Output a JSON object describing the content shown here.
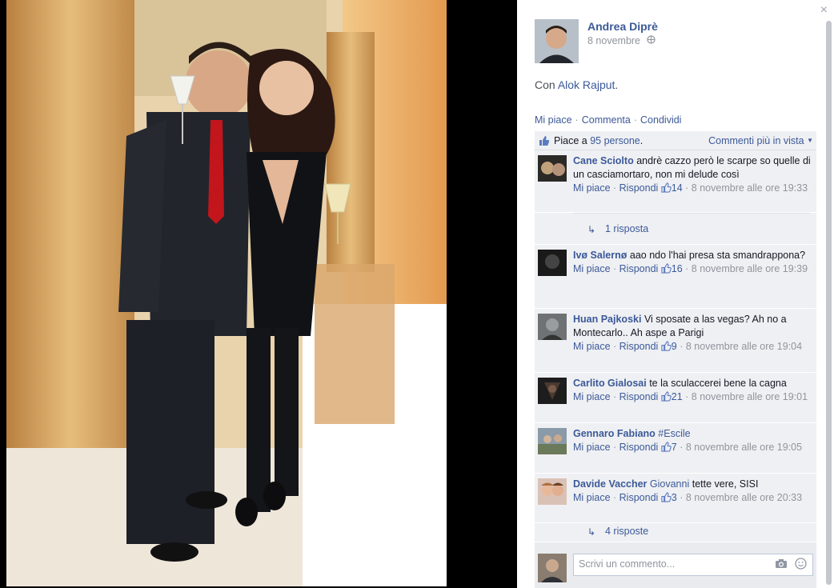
{
  "post": {
    "author": "Andrea Diprè",
    "date": "8 novembre",
    "with_prefix": "Con",
    "with_person": "Alok Rajput",
    "with_suffix": ".",
    "actions": [
      "Mi piace",
      "Commenta",
      "Condividi"
    ],
    "likes_prefix": "Piace a",
    "likes_link": "95 persone",
    "likes_suffix": ".",
    "sort_label": "Commenti più in vista"
  },
  "comments": [
    {
      "name": "Cane Sciolto",
      "text": "andrè cazzo però le scarpe so quelle di un casciamortaro, non mi delude così",
      "like": "Mi piace",
      "reply": "Rispondi",
      "count": "14",
      "date": "8 novembre alle ore 19:33",
      "replies": "1 risposta"
    },
    {
      "name": "Ivø Salernø",
      "text": "aao ndo l'hai presa sta smandrappona?",
      "like": "Mi piace",
      "reply": "Rispondi",
      "count": "16",
      "date": "8 novembre alle ore 19:39"
    },
    {
      "name": "Huan Pajkoski",
      "text": "Vi sposate a las vegas? Ah no a Montecarlo.. Ah aspe a Parigi",
      "like": "Mi piace",
      "reply": "Rispondi",
      "count": "9",
      "date": "8 novembre alle ore 19:04"
    },
    {
      "name": "Carlito Gialosai",
      "text": "te la sculaccerei bene la cagna",
      "like": "Mi piace",
      "reply": "Rispondi",
      "count": "21",
      "date": "8 novembre alle ore 19:01"
    },
    {
      "name": "Gennaro Fabiano",
      "text": "#Escile",
      "like": "Mi piace",
      "reply": "Rispondi",
      "count": "7",
      "date": "8 novembre alle ore 19:05"
    },
    {
      "name": "Davide Vaccher",
      "tag": "Giovanni",
      "text": "tette vere, SISI",
      "like": "Mi piace",
      "reply": "Rispondi",
      "count": "3",
      "date": "8 novembre alle ore 20:33",
      "replies": "4 risposte"
    }
  ],
  "composer": {
    "placeholder": "Scrivi un commento..."
  },
  "close_label": "×",
  "colors": {
    "link": "#3b5998",
    "muted": "#90949c"
  },
  "icons": [
    "close-icon",
    "globe-icon",
    "thumbs-up-icon",
    "reply-arrow-icon",
    "camera-icon",
    "emoji-icon"
  ]
}
